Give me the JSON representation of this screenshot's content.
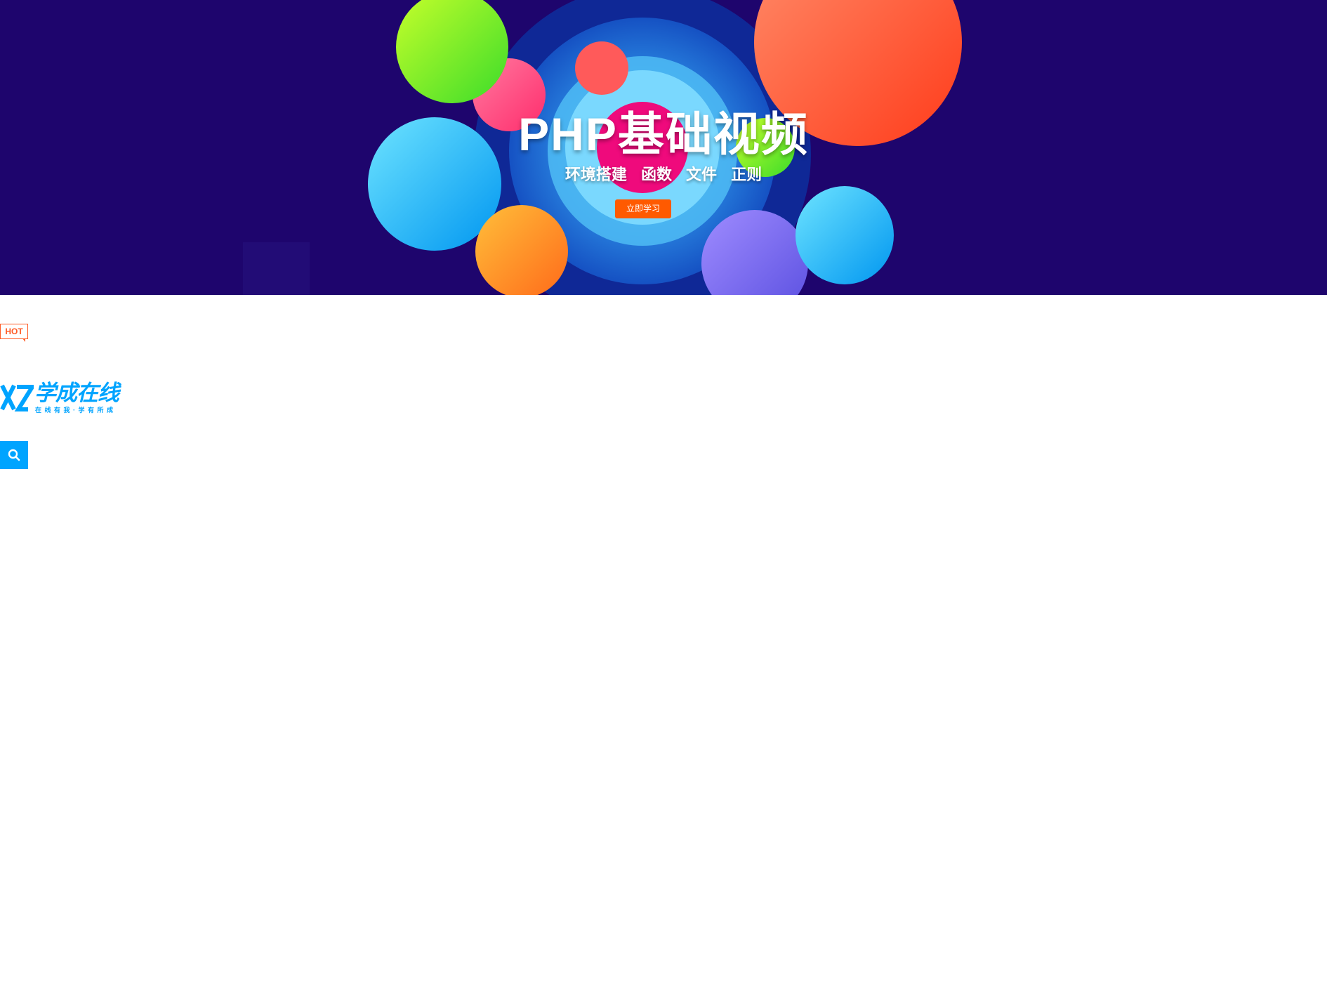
{
  "banner": {
    "title": "PHP基础视频",
    "topics": "环境搭建  函数 文件  正则",
    "cta_label": "立即学习",
    "background_color": "#1e056d",
    "cta_color": "#ff5a00"
  },
  "hot_badge": {
    "label": "HOT",
    "color": "#ff5a24"
  },
  "logo": {
    "name": "学成在线",
    "slogan": "在线有我·学有所成",
    "color": "#00a4ff",
    "icon": "xc-logo-icon"
  },
  "search": {
    "icon": "search-icon",
    "color": "#00a4ff"
  }
}
